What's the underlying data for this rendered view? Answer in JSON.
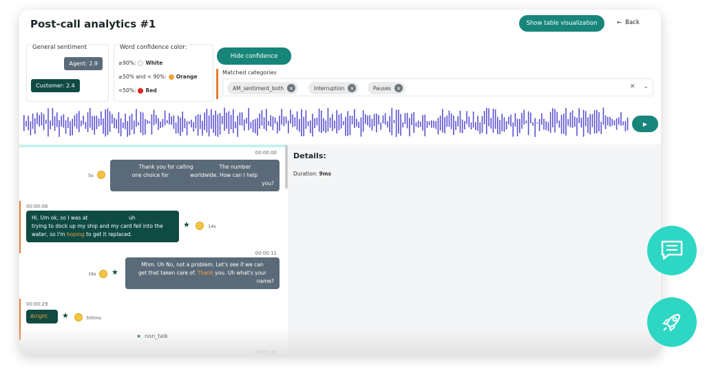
{
  "header": {
    "title": "Post-call analytics #1",
    "table_button": "Show table visualization",
    "back": "Back"
  },
  "sentiment": {
    "label": "General sentiment",
    "agent": "Agent: 2.9",
    "customer": "Customer: 2.4"
  },
  "confidence": {
    "label": "Word confidence color:",
    "rows": [
      {
        "text": "≥90%:",
        "name": "White",
        "color": "#ffffff"
      },
      {
        "text": "≥50% and < 90%:",
        "name": "Orange",
        "color": "#f2a33a"
      },
      {
        "text": "<50%:",
        "name": "Red",
        "color": "#e0261b"
      }
    ]
  },
  "hide_confidence": "Hide confidence",
  "categories": {
    "label": "Matched categories",
    "chips": [
      "AM_sentiment_both",
      "Interruption",
      "Pauses"
    ]
  },
  "player": {
    "play_icon": "play-icon"
  },
  "chat": {
    "messages": [
      {
        "time": "00:00:00",
        "text_a": "Thank you for calling",
        "text_b": "The number",
        "text_c": "one choice for",
        "text_d": "worldwide. How can I help",
        "text_e": "you?",
        "meta": "5s"
      },
      {
        "time": "00:00:06",
        "text_a": "Hi. Um ok, so I was at",
        "text_b": "uh",
        "text_c": "trying to dock up my ship and my card fell into the",
        "text_d": "water, so I'm ",
        "hl": "hoping",
        "text_e": " to get it replaced.",
        "meta": "14s"
      },
      {
        "time": "00:00:11",
        "text_a": "Mhm. Uh No, not a problem. Let's see if we can",
        "text_b": "get that taken care of. ",
        "hl": "Thank",
        "text_c": " you. Uh what's your",
        "text_d": "name?",
        "meta": "16s"
      },
      {
        "time": "00:00:29",
        "hl": "Alright.",
        "meta": "500ms"
      },
      {
        "time": "00:00:32"
      }
    ],
    "non_talk": "non_talk"
  },
  "details": {
    "title": "Details:",
    "duration_label": "Duration: ",
    "duration_value": "9ms"
  }
}
